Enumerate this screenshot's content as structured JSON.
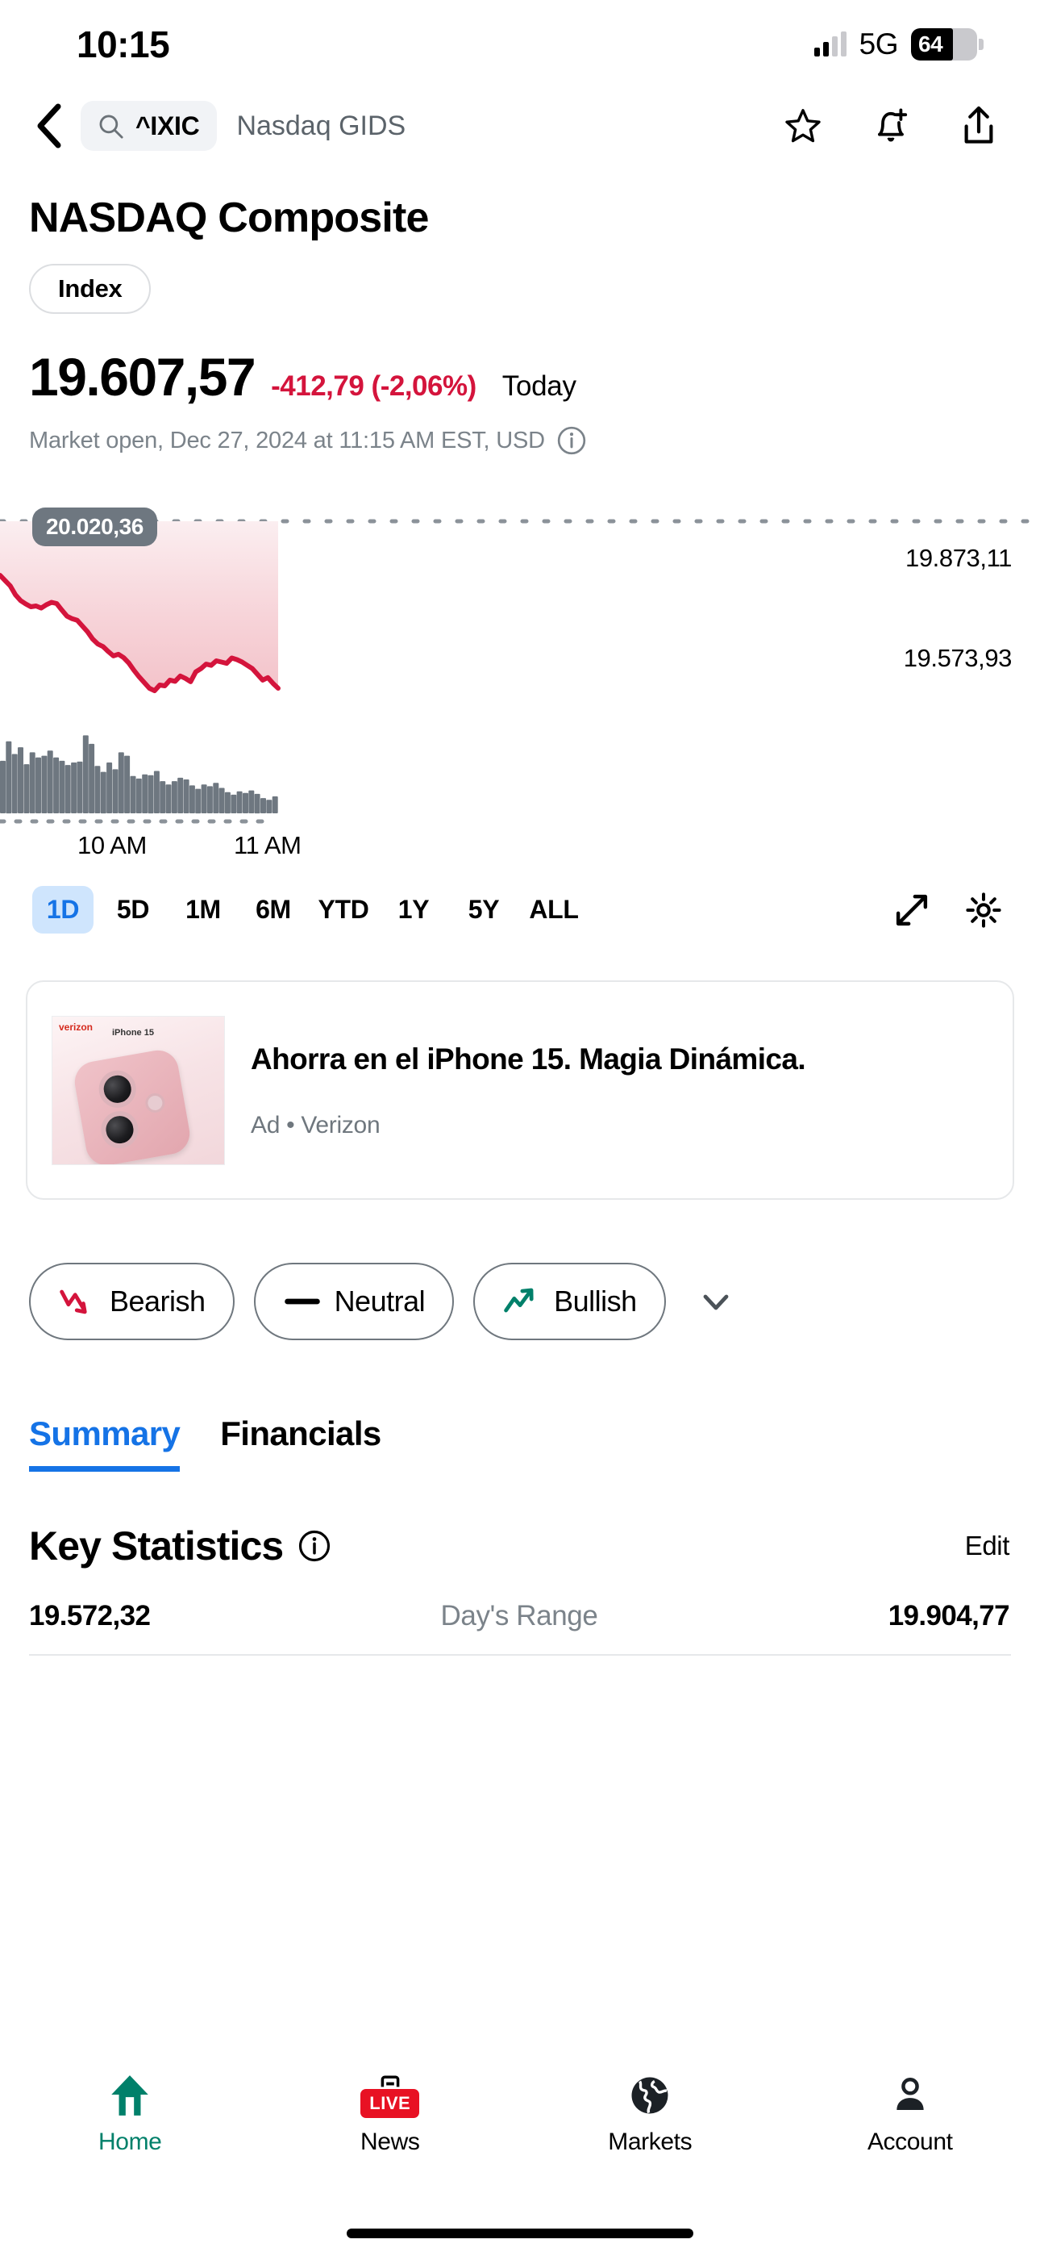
{
  "status_bar": {
    "time": "10:15",
    "network": "5G",
    "battery_percent": "64"
  },
  "nav": {
    "back_icon": "chevron-left-icon",
    "search_symbol": "^IXIC",
    "search_name": "Nasdaq GIDS",
    "favorite_icon": "star-icon",
    "alert_icon": "bell-plus-icon",
    "share_icon": "share-icon"
  },
  "quote": {
    "title": "NASDAQ Composite",
    "badge": "Index",
    "price": "19.607,57",
    "change": "-412,79 (-2,06%)",
    "change_color": "#d4143c",
    "period": "Today",
    "market_status": "Market open, Dec 27, 2024 at 11:15 AM EST, USD",
    "info_icon": "info-icon"
  },
  "chart_data": {
    "type": "line",
    "title": "NASDAQ Composite intraday",
    "xlabel": "",
    "ylabel": "",
    "line_color": "#d4143c",
    "fill_color": "#f6c8ce",
    "volume_color": "#6e7780",
    "reference_line_value": "20.020,36",
    "axis_labels": [
      "19.873,11",
      "19.573,93"
    ],
    "ylim": [
      19520,
      20060
    ],
    "tick_labels": [
      "10 AM",
      "11 AM"
    ],
    "grid": false,
    "x": [
      0,
      1,
      2,
      3,
      4,
      5,
      6,
      7,
      8,
      9,
      10,
      11,
      12,
      13,
      14,
      15,
      16,
      17,
      18,
      19,
      20,
      21,
      22,
      23,
      24,
      25,
      26,
      27,
      28,
      29,
      30,
      31,
      32,
      33,
      34,
      35,
      36,
      37,
      38,
      39,
      40,
      41,
      42,
      43,
      44,
      45,
      46,
      47,
      48,
      49,
      50,
      51,
      52,
      53,
      54
    ],
    "values": [
      19928,
      19915,
      19902,
      19880,
      19866,
      19858,
      19851,
      19853,
      19848,
      19856,
      19862,
      19859,
      19843,
      19828,
      19822,
      19818,
      19804,
      19790,
      19772,
      19760,
      19754,
      19742,
      19731,
      19735,
      19727,
      19714,
      19696,
      19680,
      19666,
      19652,
      19646,
      19660,
      19658,
      19672,
      19669,
      19682,
      19676,
      19668,
      19692,
      19700,
      19711,
      19708,
      19719,
      19716,
      19713,
      19726,
      19722,
      19716,
      19708,
      19700,
      19686,
      19672,
      19678,
      19664,
      19652
    ],
    "volume": [
      62,
      85,
      70,
      78,
      58,
      72,
      66,
      68,
      74,
      66,
      62,
      57,
      60,
      61,
      92,
      82,
      56,
      49,
      60,
      52,
      72,
      68,
      44,
      41,
      46,
      45,
      50,
      38,
      34,
      38,
      42,
      40,
      33,
      29,
      34,
      32,
      36,
      30,
      25,
      22,
      26,
      24,
      27,
      23,
      18,
      16,
      20
    ],
    "ranges": [
      {
        "label": "1D",
        "active": true
      },
      {
        "label": "5D",
        "active": false
      },
      {
        "label": "1M",
        "active": false
      },
      {
        "label": "6M",
        "active": false
      },
      {
        "label": "YTD",
        "active": false
      },
      {
        "label": "1Y",
        "active": false
      },
      {
        "label": "5Y",
        "active": false
      },
      {
        "label": "ALL",
        "active": false
      }
    ],
    "tools": [
      "expand-icon",
      "settings-gear-icon"
    ]
  },
  "ad": {
    "headline": "Ahorra en el iPhone 15. Magia Dinámica.",
    "subtitle": "Ad • Verizon",
    "brand_mark": "verizon",
    "thumb_caption": "iPhone 15"
  },
  "sentiment": {
    "options": [
      {
        "label": "Bearish",
        "icon": "trend-down-icon",
        "color": "#d4143c"
      },
      {
        "label": "Neutral",
        "icon": "dash-icon",
        "color": "#000000"
      },
      {
        "label": "Bullish",
        "icon": "trend-up-icon",
        "color": "#00806a"
      }
    ],
    "expand_icon": "chevron-down-icon"
  },
  "tabs": [
    {
      "label": "Summary",
      "active": true
    },
    {
      "label": "Financials",
      "active": false
    }
  ],
  "key_statistics": {
    "title": "Key Statistics",
    "info_icon": "info-icon",
    "edit_label": "Edit",
    "rows": [
      {
        "low": "19.572,32",
        "label": "Day's Range",
        "high": "19.904,77"
      }
    ]
  },
  "bottom_nav": [
    {
      "label": "Home",
      "icon": "home-arrow-icon",
      "active": true
    },
    {
      "label": "News",
      "icon": "news-live-icon",
      "badge": "LIVE",
      "active": false
    },
    {
      "label": "Markets",
      "icon": "globe-icon",
      "active": false
    },
    {
      "label": "Account",
      "icon": "person-icon",
      "active": false
    }
  ]
}
